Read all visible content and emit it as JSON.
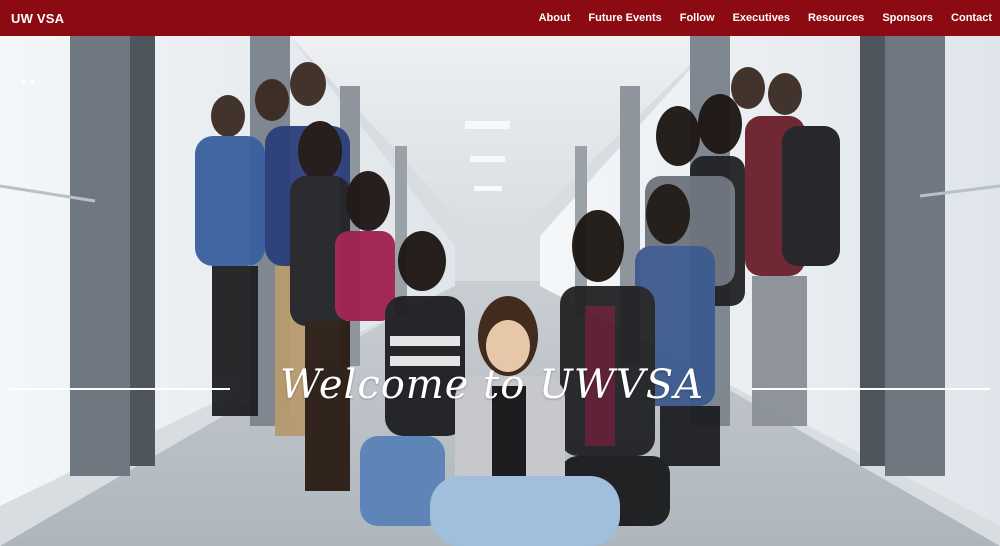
{
  "navbar": {
    "brand": "UW VSA",
    "links": [
      "About",
      "Future Events",
      "Follow",
      "Executives",
      "Resources",
      "Sponsors",
      "Contact"
    ],
    "background": "#8c0a12"
  },
  "hero": {
    "headline": "Welcome to UWVSA",
    "image_description_icon": "group-photo",
    "slide_count": 2
  }
}
